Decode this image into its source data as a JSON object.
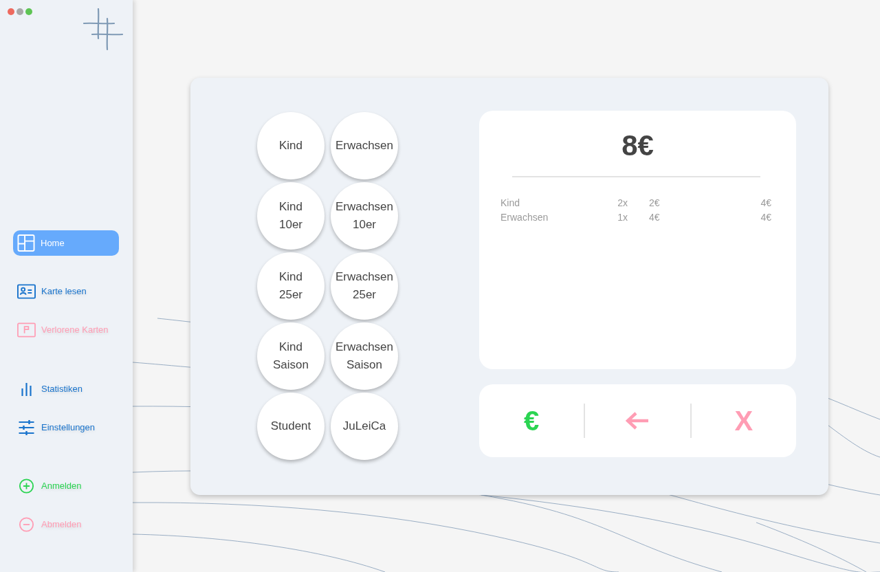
{
  "sidebar": {
    "groups": [
      {
        "items": [
          {
            "kind": "dashboard",
            "label": "Home",
            "selected": true,
            "color": "#66aafc"
          }
        ]
      },
      {
        "items": [
          {
            "kind": "card",
            "label": "Karte lesen",
            "selected": false,
            "color": "#1a74cc"
          },
          {
            "kind": "flag",
            "label": "Verlorene Karten",
            "selected": false,
            "color": "#ff9db4"
          }
        ]
      },
      {
        "items": [
          {
            "kind": "stats",
            "label": "Statistiken",
            "selected": false,
            "color": "#1a74cc"
          },
          {
            "kind": "sliders",
            "label": "Einstellungen",
            "selected": false,
            "color": "#1a74cc"
          }
        ]
      },
      {
        "items": [
          {
            "kind": "plus",
            "label": "Anmelden",
            "selected": false,
            "color": "#2bd452"
          },
          {
            "kind": "minus",
            "label": "Abmelden",
            "selected": false,
            "color": "#ff9db4"
          }
        ]
      }
    ]
  },
  "products": [
    {
      "label": "Kind"
    },
    {
      "label": "Erwachsen"
    },
    {
      "label": "Kind\n10er"
    },
    {
      "label": "Erwachsen\n10er"
    },
    {
      "label": "Kind\n25er"
    },
    {
      "label": "Erwachsen\n25er"
    },
    {
      "label": "Kind\nSaison"
    },
    {
      "label": "Erwachsen\nSaison"
    },
    {
      "label": "Student"
    },
    {
      "label": "JuLeiCa"
    }
  ],
  "receipt": {
    "total": "8€",
    "items": [
      {
        "name": "Kind",
        "quantity": "2x",
        "price": "2€",
        "total": "4€"
      },
      {
        "name": "Erwachsen",
        "quantity": "1x",
        "price": "4€",
        "total": "4€"
      }
    ]
  },
  "actions": [
    {
      "kind": "text",
      "label": "€",
      "color": "#2bd452"
    },
    {
      "kind": "arrow",
      "color": "#ff9db4"
    },
    {
      "kind": "text",
      "label": "X",
      "color": "#ff9db4"
    }
  ]
}
